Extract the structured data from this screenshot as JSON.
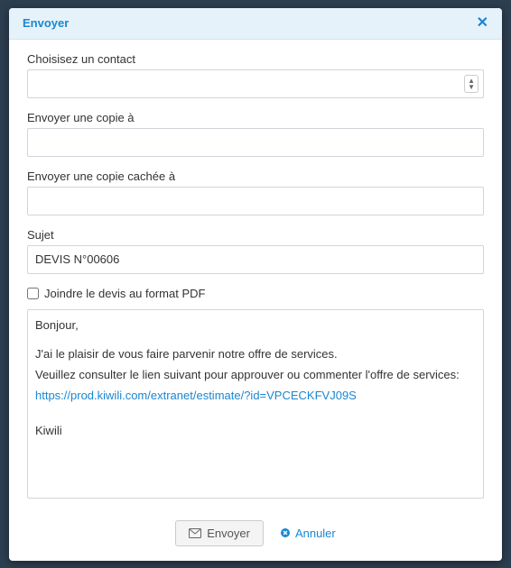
{
  "dialog": {
    "title": "Envoyer"
  },
  "form": {
    "contact_label": "Choisisez un contact",
    "contact_value": "",
    "cc_label": "Envoyer une copie à",
    "cc_value": "",
    "bcc_label": "Envoyer une copie cachée à",
    "bcc_value": "",
    "subject_label": "Sujet",
    "subject_value": "DEVIS N°00606",
    "attach_pdf_label": "Joindre le devis au format PDF",
    "attach_pdf_checked": false
  },
  "message": {
    "greeting": "Bonjour,",
    "line1": "J'ai le plaisir de vous faire parvenir notre offre de services.",
    "line2": "Veuillez consulter le lien suivant pour approuver ou commenter l'offre de services:",
    "link": "https://prod.kiwili.com/extranet/estimate/?id=VPCECKFVJ09S",
    "signature": "Kiwili"
  },
  "footer": {
    "send_label": "Envoyer",
    "cancel_label": "Annuler"
  }
}
